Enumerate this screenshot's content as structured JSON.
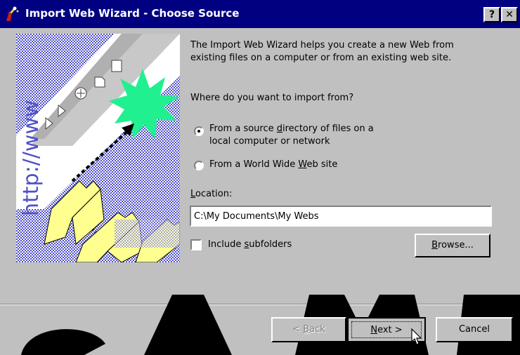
{
  "window": {
    "title": "Import Web Wizard - Choose Source",
    "help_label": "?",
    "close_label": "✕"
  },
  "intro": {
    "line1": "The Import Web Wizard helps you create a new Web from",
    "line2": "existing files on a computer or from an existing web site."
  },
  "question": "Where do you want to import from?",
  "options": [
    {
      "line1_pre": "From a source ",
      "line1_ul": "d",
      "line1_post": "irectory of files on a",
      "line2": "local computer or network",
      "selected": true
    },
    {
      "line1_pre": "From a World Wide ",
      "line1_ul": "W",
      "line1_post": "eb site",
      "selected": false
    }
  ],
  "location": {
    "label_ul": "L",
    "label_rest": "ocation:",
    "value": "C:\\My Documents\\My Webs"
  },
  "subfolders": {
    "label_pre": "Include ",
    "label_ul": "s",
    "label_post": "ubfolders",
    "checked": false
  },
  "buttons": {
    "browse_ul": "B",
    "browse_rest": "rowse...",
    "back_pre": "< ",
    "back_ul": "B",
    "back_post": "ack",
    "next_ul": "N",
    "next_post": "ext >",
    "cancel": "Cancel"
  },
  "illustration": {
    "vertical_text": "http://www"
  },
  "watermark": "SAMPLE"
}
